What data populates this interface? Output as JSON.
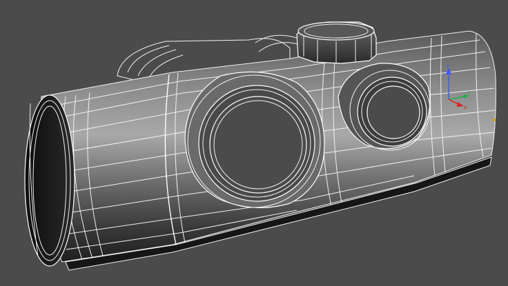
{
  "viewport": {
    "background": "#4b4b4b",
    "wireframe_color": "#ffffff"
  },
  "model": {
    "shading": "grey-gradient-with-wireframe"
  },
  "gizmo": {
    "axes": [
      {
        "label": "z",
        "color": "#3a5bff"
      },
      {
        "label": "y",
        "color": "#22b14c"
      },
      {
        "label": "x",
        "color": "#e02020"
      }
    ]
  }
}
